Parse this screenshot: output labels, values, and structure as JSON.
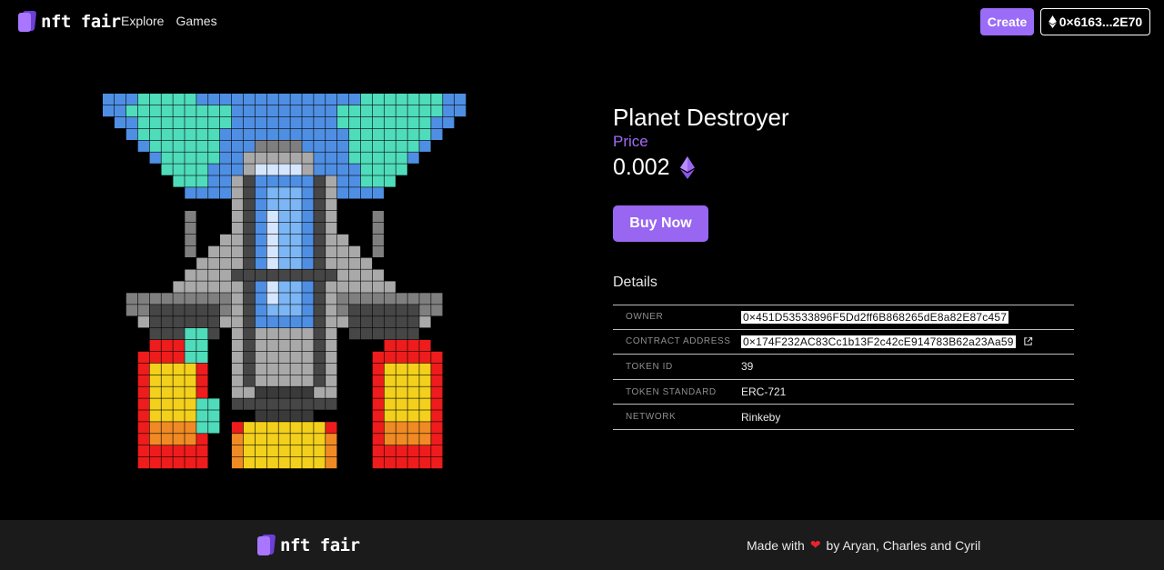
{
  "header": {
    "brand": "nft fair",
    "nav": [
      "Explore",
      "Games"
    ],
    "create_label": "Create",
    "wallet_label": "0×6163...2E70",
    "eth_icon": "ethereum-icon"
  },
  "nft": {
    "title": "Planet Destroyer",
    "price_label": "Price",
    "price": "0.002",
    "currency_icon": "ethereum-icon",
    "buy_label": "Buy Now",
    "details_heading": "Details",
    "details": [
      {
        "key": "OWNER",
        "value": "0×451D53533896F5Dd2ff6B868265dE8a82E87c457",
        "highlighted": true
      },
      {
        "key": "CONTRACT ADDRESS",
        "value": "0×174F232AC83Cc1b13F2c42cE914783B62a23Aa59",
        "highlighted": true,
        "icon": "external-link-icon"
      },
      {
        "key": "TOKEN ID",
        "value": "39"
      },
      {
        "key": "TOKEN STANDARD",
        "value": "ERC-721"
      },
      {
        "key": "NETWORK",
        "value": "Rinkeby"
      }
    ]
  },
  "footer": {
    "brand": "nft fair",
    "made_with": "Made with",
    "credits": "by Aryan, Charles and Cyril",
    "heart_icon": "heart-icon"
  },
  "colors": {
    "accent": "#9b6cf7",
    "background": "#000000",
    "footer_bg": "#1b1b1b"
  }
}
